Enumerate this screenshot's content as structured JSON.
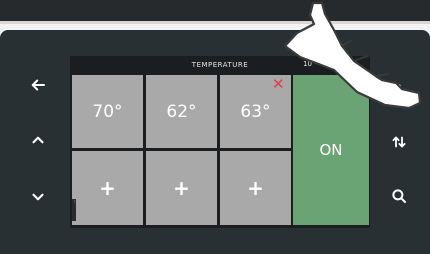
{
  "screen": {
    "title": "TEMPERATURE",
    "time_fragment": "10",
    "temps": [
      "70°",
      "62°",
      "63°"
    ],
    "add_label": "+",
    "power_label": "ON",
    "close_symbol": "✕"
  },
  "icons": {
    "left": "arrow-left-icon",
    "up": "chevron-up-icon",
    "down": "chevron-down-icon",
    "sort": "sort-arrows-icon",
    "search": "search-icon",
    "menu": "more-icon",
    "close": "close-icon"
  },
  "colors": {
    "panel": "#283034",
    "tile": "#a9a9a9",
    "on": "#6aa475",
    "close": "#e5394b"
  }
}
